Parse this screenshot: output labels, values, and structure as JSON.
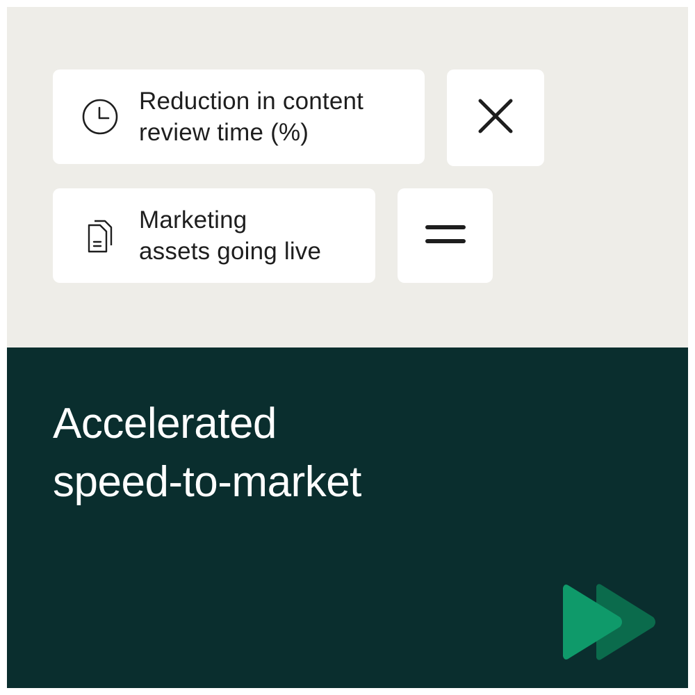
{
  "colors": {
    "top_background": "#eeede8",
    "bottom_background": "#0a2e2e",
    "card_background": "#ffffff",
    "text_dark": "#1e1e1e",
    "text_light": "#ffffff",
    "accent_green": "#0f9a6a",
    "accent_green_dark": "#0b6b4c"
  },
  "metrics": [
    {
      "icon": "clock-icon",
      "label": "Reduction in content\nreview time (%)",
      "operator_icon": "multiply-icon"
    },
    {
      "icon": "documents-icon",
      "label": "Marketing\nassets going live",
      "operator_icon": "equals-icon"
    }
  ],
  "headline": "Accelerated\nspeed-to-market",
  "badge_icon": "fast-forward-icon"
}
